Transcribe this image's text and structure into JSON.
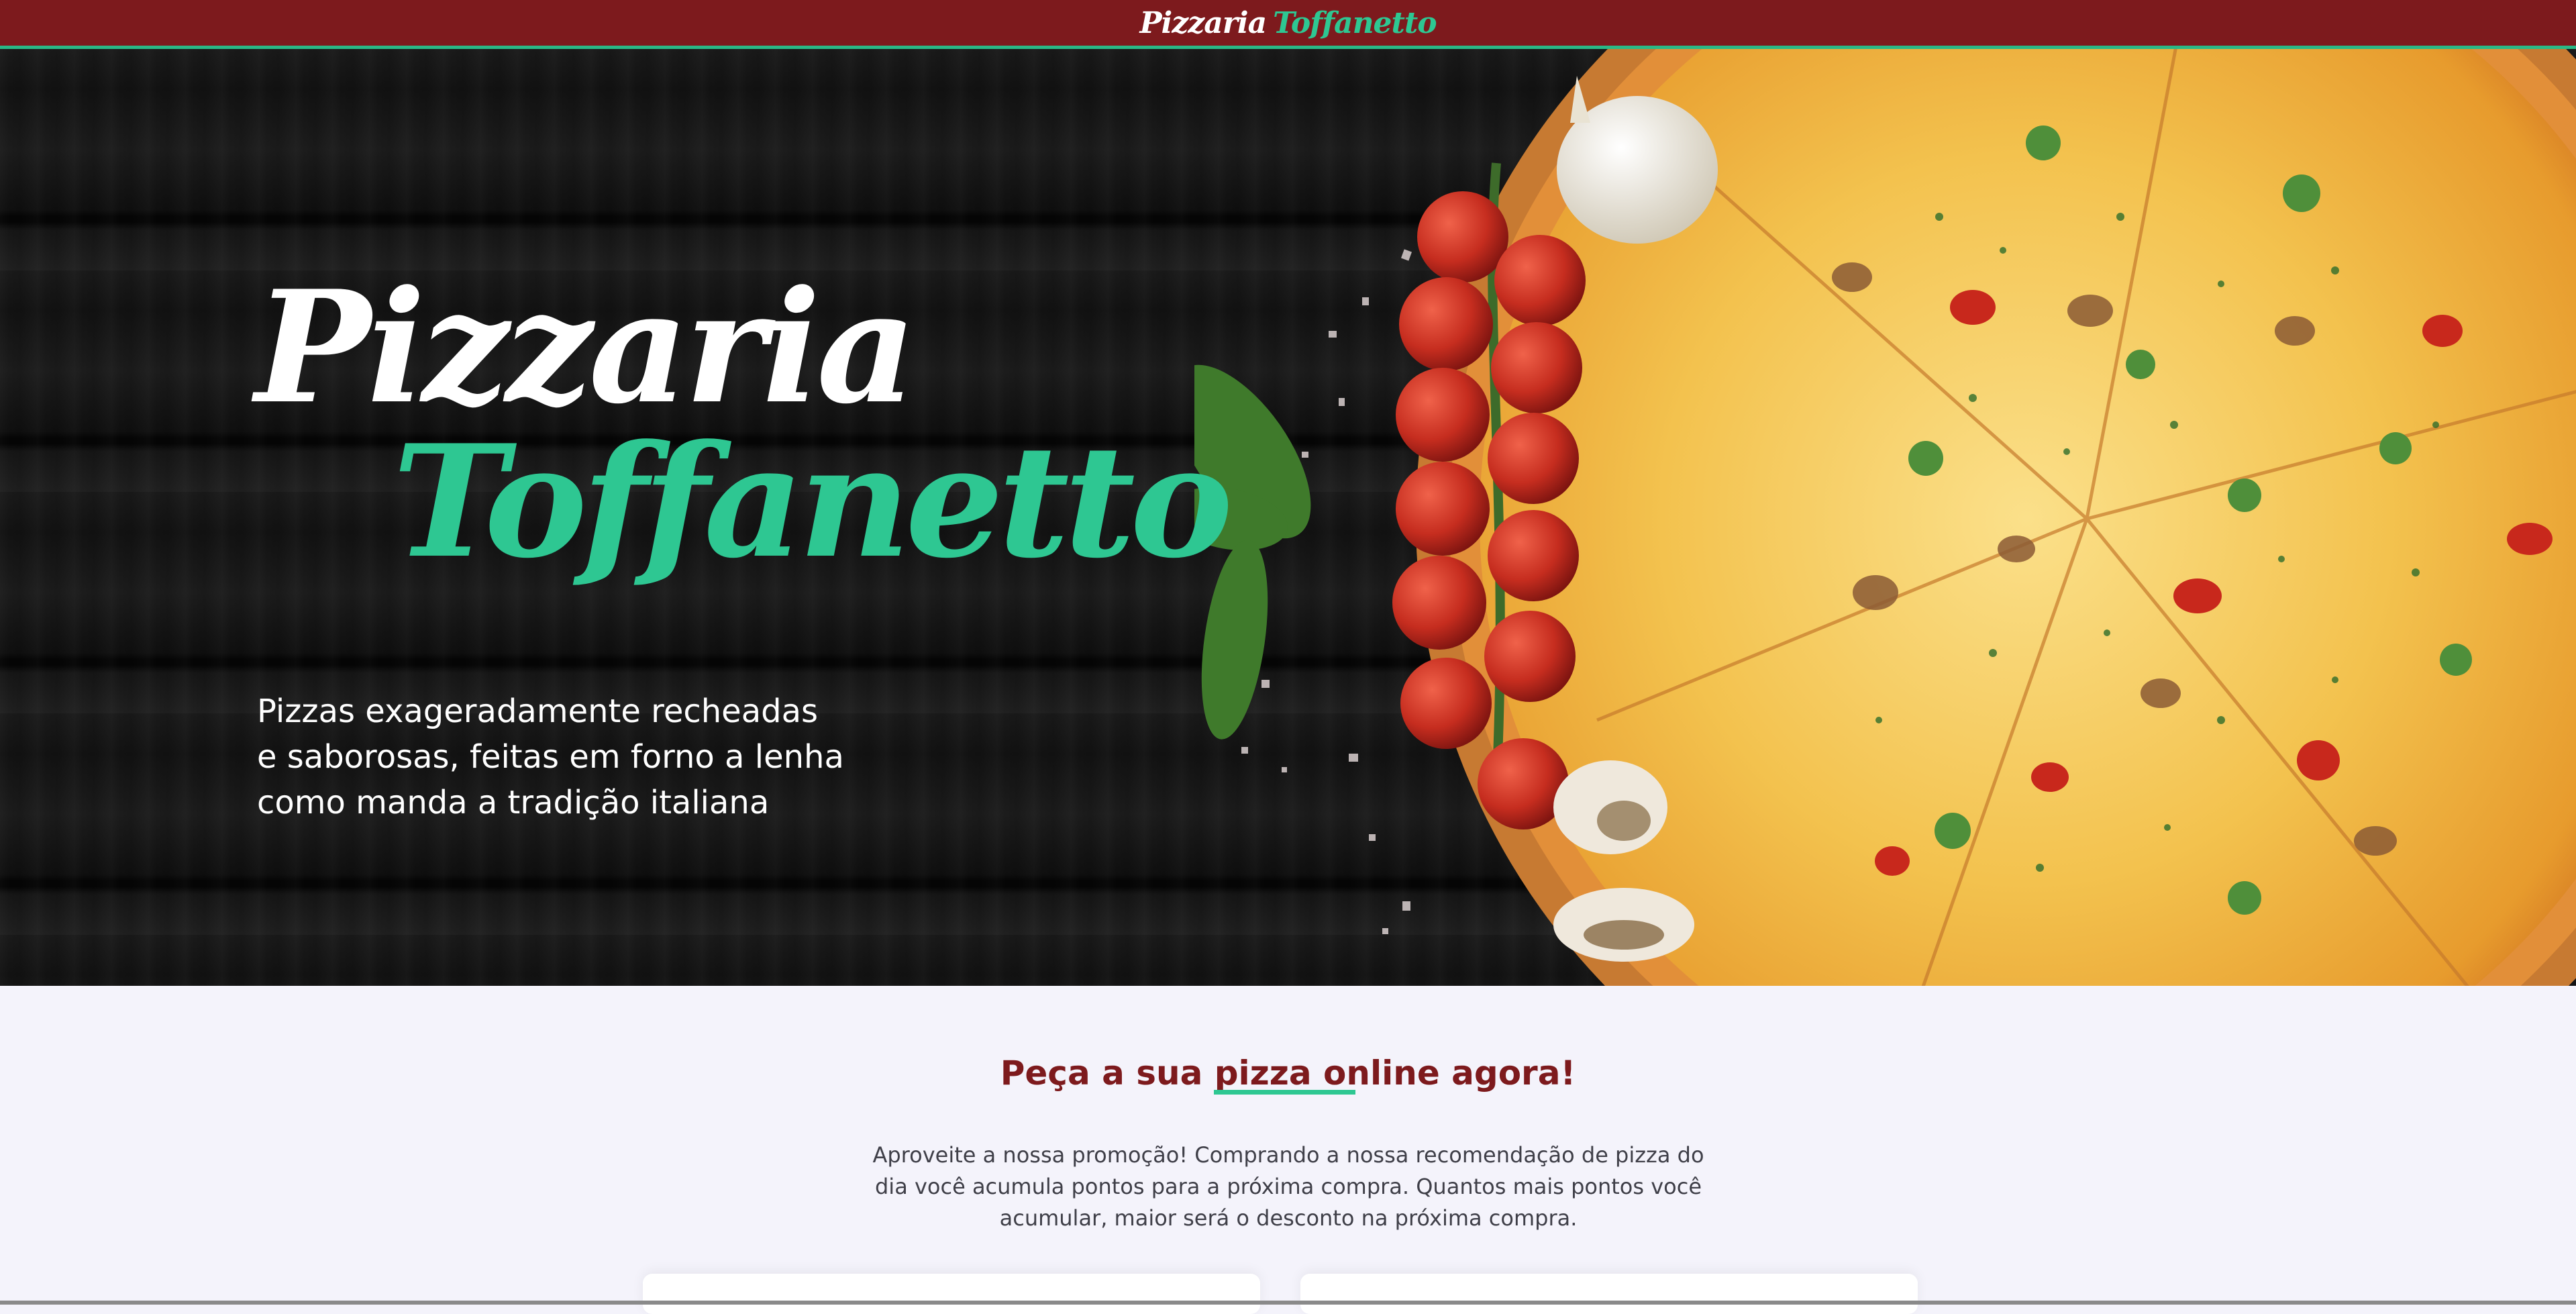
{
  "header": {
    "brand_part1": "Pizzaria",
    "brand_part2": "Toffanetto"
  },
  "hero": {
    "title_line1": "Pizzaria",
    "title_line2": "Toffanetto",
    "description": "Pizzas exageradamente recheadas e saborosas, feitas em forno a lenha como manda a tradição italiana"
  },
  "promo": {
    "title": "Peça a sua pizza online agora!",
    "text": "Aproveite a nossa promoção! Comprando a nossa recomendação de pizza do dia você acumula pontos para a próxima compra. Quantos mais pontos você acumular, maior será o desconto na próxima compra."
  },
  "colors": {
    "brand_red": "#7d1a1d",
    "brand_green": "#2ec792",
    "page_background": "#f4f3fb"
  }
}
